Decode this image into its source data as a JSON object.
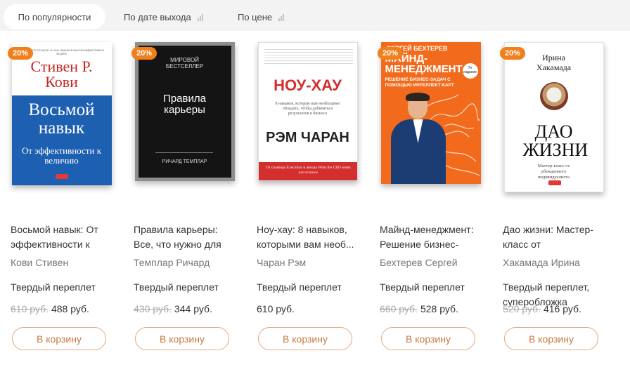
{
  "sort": {
    "tabs": [
      {
        "label": "По популярности"
      },
      {
        "label": "По дате выхода"
      },
      {
        "label": "По цене"
      }
    ]
  },
  "colors": {
    "accent": "#f07f1c",
    "button_border": "#e2a77e",
    "button_text": "#c87a43"
  },
  "products": [
    {
      "badge": "20%",
      "title": "Восьмой навык: От эффективности к",
      "author": "Кови Стивен",
      "format": "Твердый переплет",
      "old_price": "610 руб.",
      "price": "488 руб.",
      "button": "В корзину",
      "cover": {
        "top_small": "Автор бестселлеров «Семь навыков высокоэффективных людей»",
        "author": "Стивен Р. Кови",
        "title": "Восьмой навык",
        "subtitle": "От эффективности к величию"
      }
    },
    {
      "badge": "20%",
      "title": "Правила карьеры: Все, что нужно для",
      "author": "Темплар Ричард",
      "format": "Твердый переплет",
      "old_price": "430 руб.",
      "price": "344 руб.",
      "button": "В корзину",
      "cover": {
        "top_small": "МИРОВОЙ БЕСТСЕЛЛЕР",
        "title": "Правила карьеры",
        "author": "РИЧАРД ТЕМПЛАР"
      }
    },
    {
      "badge": "",
      "title": "Ноу-хау: 8 навыков, которыми вам необ...",
      "author": "Чаран Рэм",
      "format": "Твердый переплет",
      "old_price": "",
      "price": "610 руб.",
      "button": "В корзину",
      "cover": {
        "title": "НОУ-ХАУ",
        "subtitle": "8 навыков, которые вам необходимо обладать, чтобы добиваться результатов в бизнесе",
        "author": "РЭМ ЧАРАН",
        "bottom_small": "От соавтора Execution и автора What the CEO wants you to know"
      }
    },
    {
      "badge": "20%",
      "title": "Майнд-менеджмент: Решение бизнес-",
      "author": "Бехтерев Сергей",
      "format": "Твердый переплет",
      "old_price": "660 руб.",
      "price": "528 руб.",
      "button": "В корзину",
      "cover": {
        "author": "СЕРГЕЙ БЕХТЕРЕВ",
        "title": "МАЙНД-МЕНЕДЖМЕНТ",
        "subtitle": "РЕШЕНИЕ БИЗНЕС-ЗАДАЧ С ПОМОЩЬЮ ИНТЕЛЛЕКТ-КАРТ",
        "edition": "7е издание"
      }
    },
    {
      "badge": "20%",
      "title": "Дао жизни: Мастер-класс от",
      "author": "Хакамада Ирина",
      "format": "Твердый переплет, суперобложка",
      "old_price": "520 руб.",
      "price": "416 руб.",
      "button": "В корзину",
      "cover": {
        "author": "Ирина Хакамада",
        "title": "ДАО ЖИЗНИ",
        "subtitle": "Мастер-класс от убежденного индивидуалиста"
      }
    }
  ]
}
